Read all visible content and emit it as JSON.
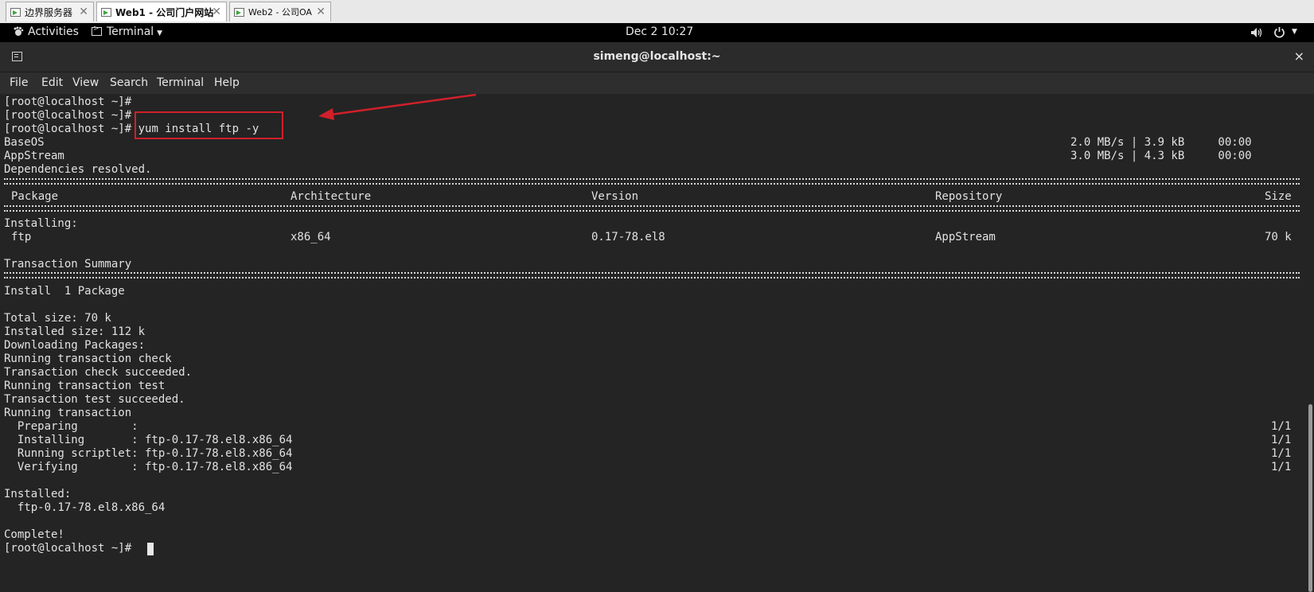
{
  "vm_tabs": [
    {
      "label": "边界服务器",
      "active": false
    },
    {
      "label": "Web1 - 公司门户网站",
      "active": true
    },
    {
      "label": "Web2 - 公司OA",
      "active": false
    }
  ],
  "topbar": {
    "activities": "Activities",
    "app_menu": "Terminal",
    "clock": "Dec 2  10:27"
  },
  "window": {
    "title": "simeng@localhost:~",
    "close_glyph": "×"
  },
  "menu": [
    "File",
    "Edit",
    "View",
    "Search",
    "Terminal",
    "Help"
  ],
  "terminal": {
    "prompt": "[root@localhost ~]#",
    "command": "yum install ftp -y",
    "repos": [
      {
        "name": "BaseOS",
        "stats": "2.0 MB/s | 3.9 kB     00:00"
      },
      {
        "name": "AppStream",
        "stats": "3.0 MB/s | 4.3 kB     00:00"
      }
    ],
    "deps": "Dependencies resolved.",
    "table_headers": {
      "package": "Package",
      "arch": "Architecture",
      "version": "Version",
      "repo": "Repository",
      "size": "Size"
    },
    "installing_label": "Installing:",
    "package_row": {
      "package": "ftp",
      "arch": "x86_64",
      "version": "0.17-78.el8",
      "repo": "AppStream",
      "size": "70 k"
    },
    "summary_title": "Transaction Summary",
    "install_count": "Install  1 Package",
    "total_size": "Total size: 70 k",
    "installed_size": "Installed size: 112 k",
    "log_lines": [
      "Downloading Packages:",
      "Running transaction check",
      "Transaction check succeeded.",
      "Running transaction test",
      "Transaction test succeeded.",
      "Running transaction"
    ],
    "steps": [
      {
        "text": "  Preparing        :",
        "count": "1/1"
      },
      {
        "text": "  Installing       : ftp-0.17-78.el8.x86_64",
        "count": "1/1"
      },
      {
        "text": "  Running scriptlet: ftp-0.17-78.el8.x86_64",
        "count": "1/1"
      },
      {
        "text": "  Verifying        : ftp-0.17-78.el8.x86_64",
        "count": "1/1"
      }
    ],
    "installed_label": "Installed:",
    "installed_pkg": "  ftp-0.17-78.el8.x86_64",
    "complete": "Complete!"
  },
  "annotation_color": "#d0202a"
}
